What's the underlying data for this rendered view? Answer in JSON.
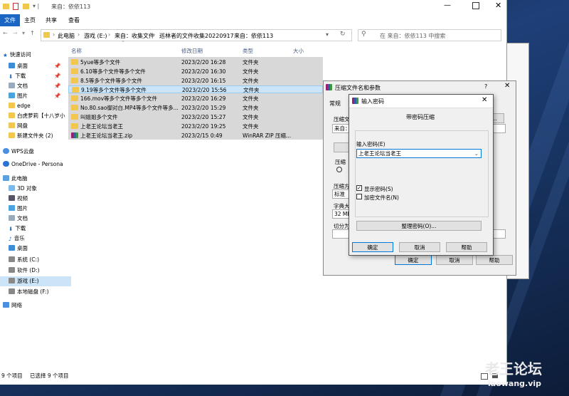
{
  "window": {
    "title": "来自：依依113"
  },
  "ribbon": {
    "tabs": [
      "文件",
      "主页",
      "共享",
      "查看"
    ]
  },
  "address": {
    "segments": [
      "此电脑",
      "游戏 (E:)",
      "来自：收集文件",
      "巡林者的文件收集20220917",
      "来自：依依113"
    ],
    "search_placeholder": "在 来自：依依113 中搜索"
  },
  "sidebar": {
    "items": [
      {
        "label": "快速访问",
        "icon": "star-icon"
      },
      {
        "label": "桌面",
        "icon": "desktop-icon"
      },
      {
        "label": "下载",
        "icon": "download-icon"
      },
      {
        "label": "文档",
        "icon": "document-icon"
      },
      {
        "label": "图片",
        "icon": "picture-icon"
      },
      {
        "label": "edge",
        "icon": "folder-icon"
      },
      {
        "label": "白虎萝莉【十八岁小",
        "icon": "folder-icon"
      },
      {
        "label": "网盘",
        "icon": "folder-icon"
      },
      {
        "label": "新建文件夹 (2)",
        "icon": "folder-icon"
      },
      {
        "label": "WPS云盘",
        "icon": "cloud-icon"
      },
      {
        "label": "OneDrive - Persona",
        "icon": "cloud-icon"
      },
      {
        "label": "此电脑",
        "icon": "computer-icon"
      },
      {
        "label": "3D 对象",
        "icon": "cube-icon"
      },
      {
        "label": "视频",
        "icon": "video-icon"
      },
      {
        "label": "图片",
        "icon": "picture-icon"
      },
      {
        "label": "文档",
        "icon": "document-icon"
      },
      {
        "label": "下载",
        "icon": "download-icon"
      },
      {
        "label": "音乐",
        "icon": "music-icon"
      },
      {
        "label": "桌面",
        "icon": "desktop-icon"
      },
      {
        "label": "系统 (C:)",
        "icon": "drive-icon"
      },
      {
        "label": "软件 (D:)",
        "icon": "drive-icon"
      },
      {
        "label": "游戏 (E:)",
        "icon": "drive-icon"
      },
      {
        "label": "本地磁盘 (F:)",
        "icon": "drive-icon"
      },
      {
        "label": "网络",
        "icon": "network-icon"
      }
    ]
  },
  "columns": [
    "名称",
    "修改日期",
    "类型",
    "大小"
  ],
  "files": [
    {
      "name": "5yue等多个文件",
      "date": "2023/2/20 16:28",
      "type": "文件夹",
      "size": ""
    },
    {
      "name": "6.10等多个文件等多个文件",
      "date": "2023/2/20 16:30",
      "type": "文件夹",
      "size": ""
    },
    {
      "name": "8.5等多个文件等多个文件",
      "date": "2023/2/20 16:15",
      "type": "文件夹",
      "size": ""
    },
    {
      "name": "9.19等多个文件等多个文件",
      "date": "2023/2/20 15:56",
      "type": "文件夹",
      "size": ""
    },
    {
      "name": "166.mov等多个文件等多个文件",
      "date": "2023/2/20 16:29",
      "type": "文件夹",
      "size": ""
    },
    {
      "name": "No.80.sao御对白.MP4等多个文件等多...",
      "date": "2023/2/20 15:29",
      "type": "文件夹",
      "size": ""
    },
    {
      "name": "叫姐姐多个文件",
      "date": "2023/2/20 15:27",
      "type": "文件夹",
      "size": ""
    },
    {
      "name": "上老王论坛当老王",
      "date": "2023/2/20 19:25",
      "type": "文件夹",
      "size": ""
    },
    {
      "name": "上老王论坛当老王.zip",
      "date": "2023/2/15 0:49",
      "type": "WinRAR ZIP 压缩...",
      "size": ""
    }
  ],
  "status": {
    "count": "9 个项目",
    "selected": "已选择 9 个项目"
  },
  "rar_dialog": {
    "title": "压缩文件名和参数",
    "tab": "常规",
    "labels": {
      "archive": "压缩文",
      "update": "更新方",
      "format": "压缩",
      "method": "压缩方",
      "dict": "字典大",
      "split": "切分为"
    },
    "values": {
      "update": "来自：",
      "method": "标准",
      "dict": "32 MB"
    },
    "ok": "确定",
    "cancel": "取消",
    "help": "帮助",
    "help_mark": "?"
  },
  "password_dialog": {
    "title": "输入密码",
    "heading": "带密码压缩",
    "input_label": "输入密码(E)",
    "password": "上老王论坛当老王",
    "show_password": "显示密码(S)",
    "encrypt_names": "加密文件名(N)",
    "organize": "整理密码(O)...",
    "ok": "确定",
    "cancel": "取消",
    "help": "帮助"
  },
  "watermark": {
    "line1": "老王论坛",
    "line2": "laowang.vip"
  },
  "colors": {
    "accent": "#1a66c2",
    "selection": "#cce4f7",
    "folder": "#f3c64e"
  }
}
